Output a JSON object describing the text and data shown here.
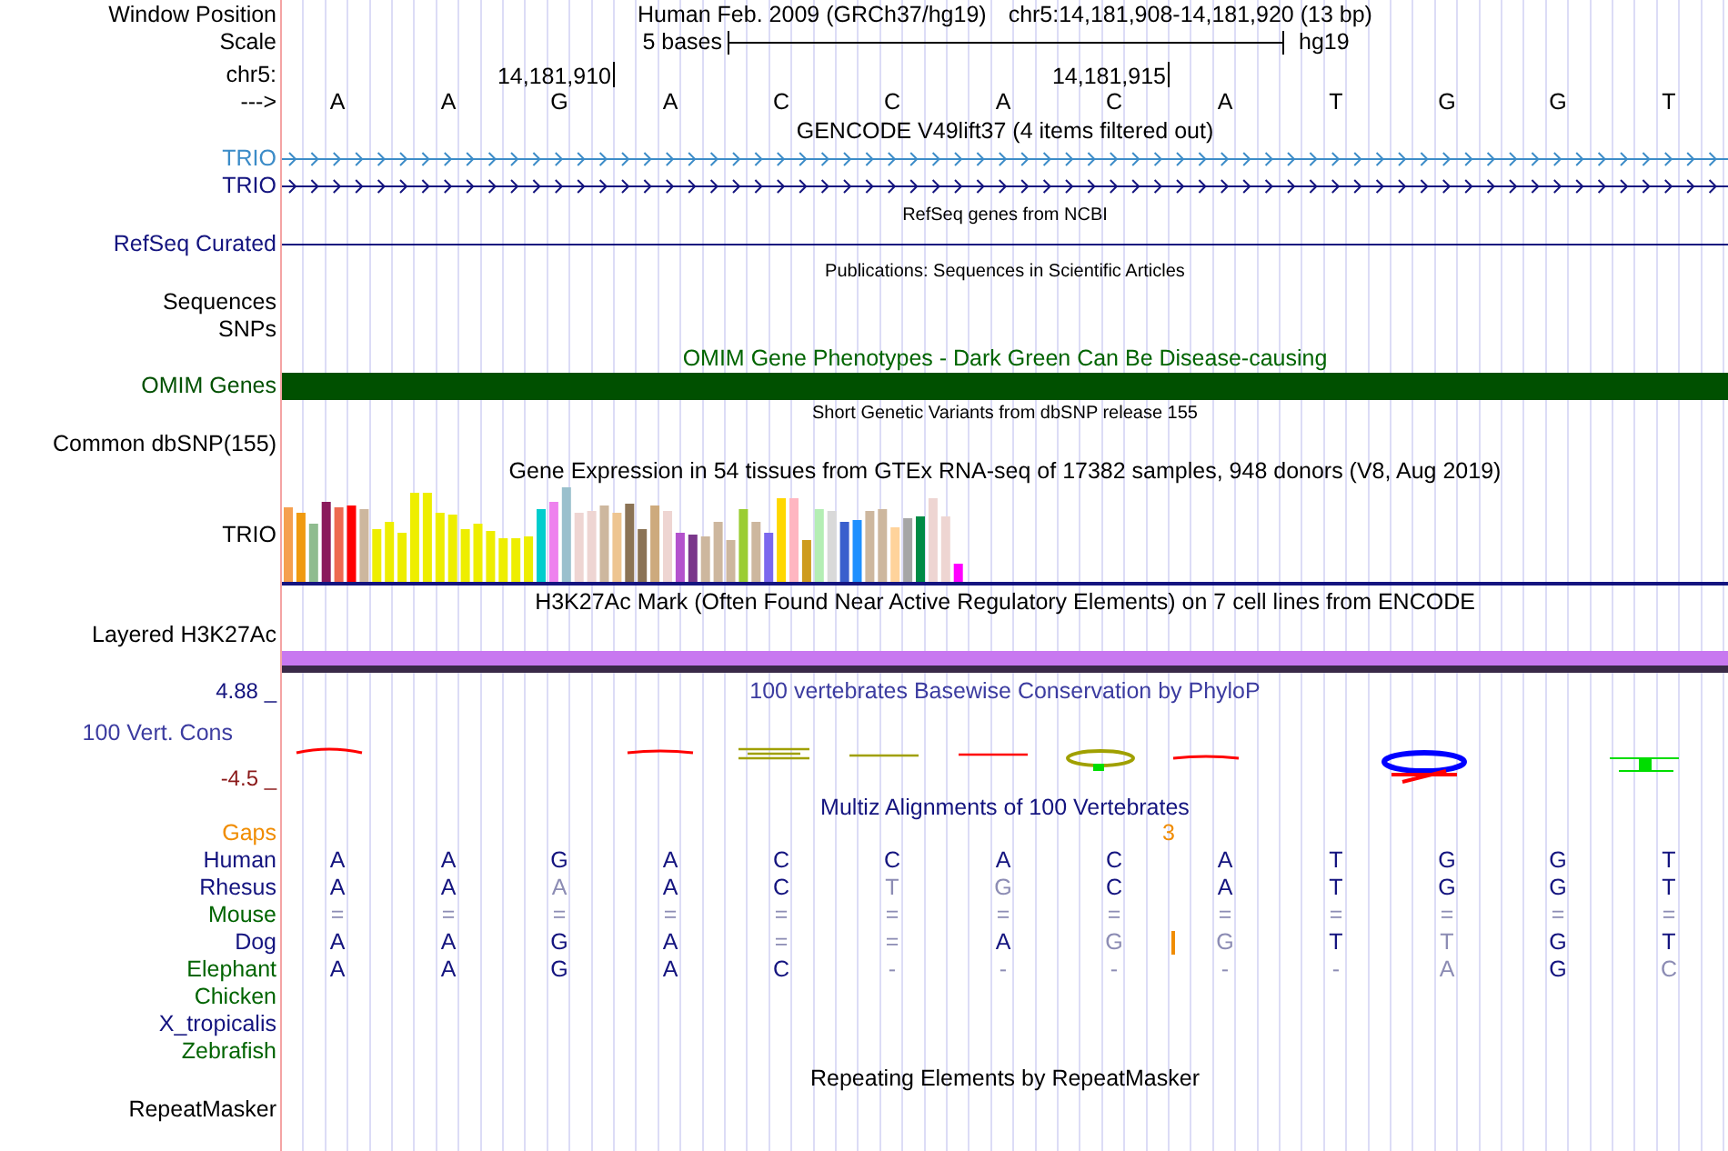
{
  "header": {
    "label": "Window Position",
    "assembly": "Human Feb. 2009 (GRCh37/hg19)",
    "range": "chr5:14,181,908-14,181,920 (13 bp)"
  },
  "scale": {
    "label": "Scale",
    "size": "5 bases",
    "assembly": "hg19"
  },
  "coordinates": {
    "label": "chr5:",
    "ticks": [
      "14,181,910",
      "14,181,915"
    ]
  },
  "strand": {
    "label": "--->",
    "bases": [
      "A",
      "A",
      "G",
      "A",
      "C",
      "C",
      "A",
      "C",
      "A",
      "T",
      "G",
      "G",
      "T"
    ]
  },
  "tracks": [
    {
      "kind": "genes",
      "title": "GENCODE V49lift37 (4 items filtered out)",
      "rows": [
        {
          "label": "TRIO",
          "color": "#3c8cc8"
        },
        {
          "label": "TRIO",
          "color": "#14147f"
        }
      ]
    },
    {
      "kind": "line",
      "title": "RefSeq genes from NCBI",
      "rows": [
        {
          "label": "RefSeq Curated",
          "color": "#14147f"
        }
      ]
    },
    {
      "kind": "empty",
      "title": "Publications: Sequences in Scientific Articles",
      "rows": [
        {
          "label": "Sequences"
        },
        {
          "label": "SNPs"
        }
      ]
    },
    {
      "kind": "bar",
      "title": "OMIM Gene Phenotypes - Dark Green Can Be Disease-causing",
      "rows": [
        {
          "label": "OMIM Genes",
          "color": "#005000"
        }
      ]
    },
    {
      "kind": "empty",
      "title": "Short Genetic Variants from dbSNP release 155",
      "rows": [
        {
          "label": "Common dbSNP(155)"
        }
      ]
    },
    {
      "kind": "expression",
      "title": "Gene Expression in 54 tissues from GTEx RNA-seq of 17382 samples, 948 donors (V8, Aug 2019)",
      "rows": [
        {
          "label": "TRIO"
        }
      ]
    },
    {
      "kind": "signal",
      "title": "H3K27Ac Mark (Often Found Near Active Regulatory Elements) on 7 cell lines from ENCODE",
      "rows": [
        {
          "label": "Layered H3K27Ac"
        }
      ]
    },
    {
      "kind": "conservation",
      "title": "100 vertebrates Basewise Conservation by PhyloP",
      "max": "4.88 _",
      "min": "-4.5 _",
      "rows": [
        {
          "label": "100 Vert. Cons"
        }
      ]
    }
  ],
  "alignment": {
    "title": "Multiz Alignments of 100 Vertebrates",
    "gaps": {
      "label": "Gaps",
      "count": "3"
    },
    "species": [
      {
        "name": "Human",
        "color": "#14147f",
        "insertion": false,
        "bases": [
          "A",
          "A",
          "G",
          "A",
          "C",
          "C",
          "A",
          "C",
          "A",
          "T",
          "G",
          "G",
          "T"
        ]
      },
      {
        "name": "Rhesus",
        "color": "#14147f",
        "insertion": false,
        "bases": [
          "A",
          "A",
          "A",
          "A",
          "C",
          "T",
          "G",
          "C",
          "A",
          "T",
          "G",
          "G",
          "T"
        ]
      },
      {
        "name": "Mouse",
        "color": "#006400",
        "insertion": false,
        "bases": [
          "=",
          "=",
          "=",
          "=",
          "=",
          "=",
          "=",
          "=",
          "=",
          "=",
          "=",
          "=",
          "="
        ]
      },
      {
        "name": "Dog",
        "color": "#14147f",
        "insertion": true,
        "bases": [
          "A",
          "A",
          "G",
          "A",
          "=",
          "=",
          "A",
          "G",
          "G",
          "T",
          "T",
          "G",
          "T"
        ]
      },
      {
        "name": "Elephant",
        "color": "#006400",
        "insertion": false,
        "bases": [
          "A",
          "A",
          "G",
          "A",
          "C",
          "-",
          "-",
          "-",
          "-",
          "-",
          "A",
          "G",
          "C"
        ]
      },
      {
        "name": "Chicken",
        "color": "#006400",
        "insertion": false
      },
      {
        "name": "X_tropicalis",
        "color": "#14147f",
        "insertion": false
      },
      {
        "name": "Zebrafish",
        "color": "#006400",
        "insertion": false
      }
    ]
  },
  "repeats": {
    "title": "Repeating Elements by RepeatMasker",
    "label": "RepeatMasker"
  }
}
